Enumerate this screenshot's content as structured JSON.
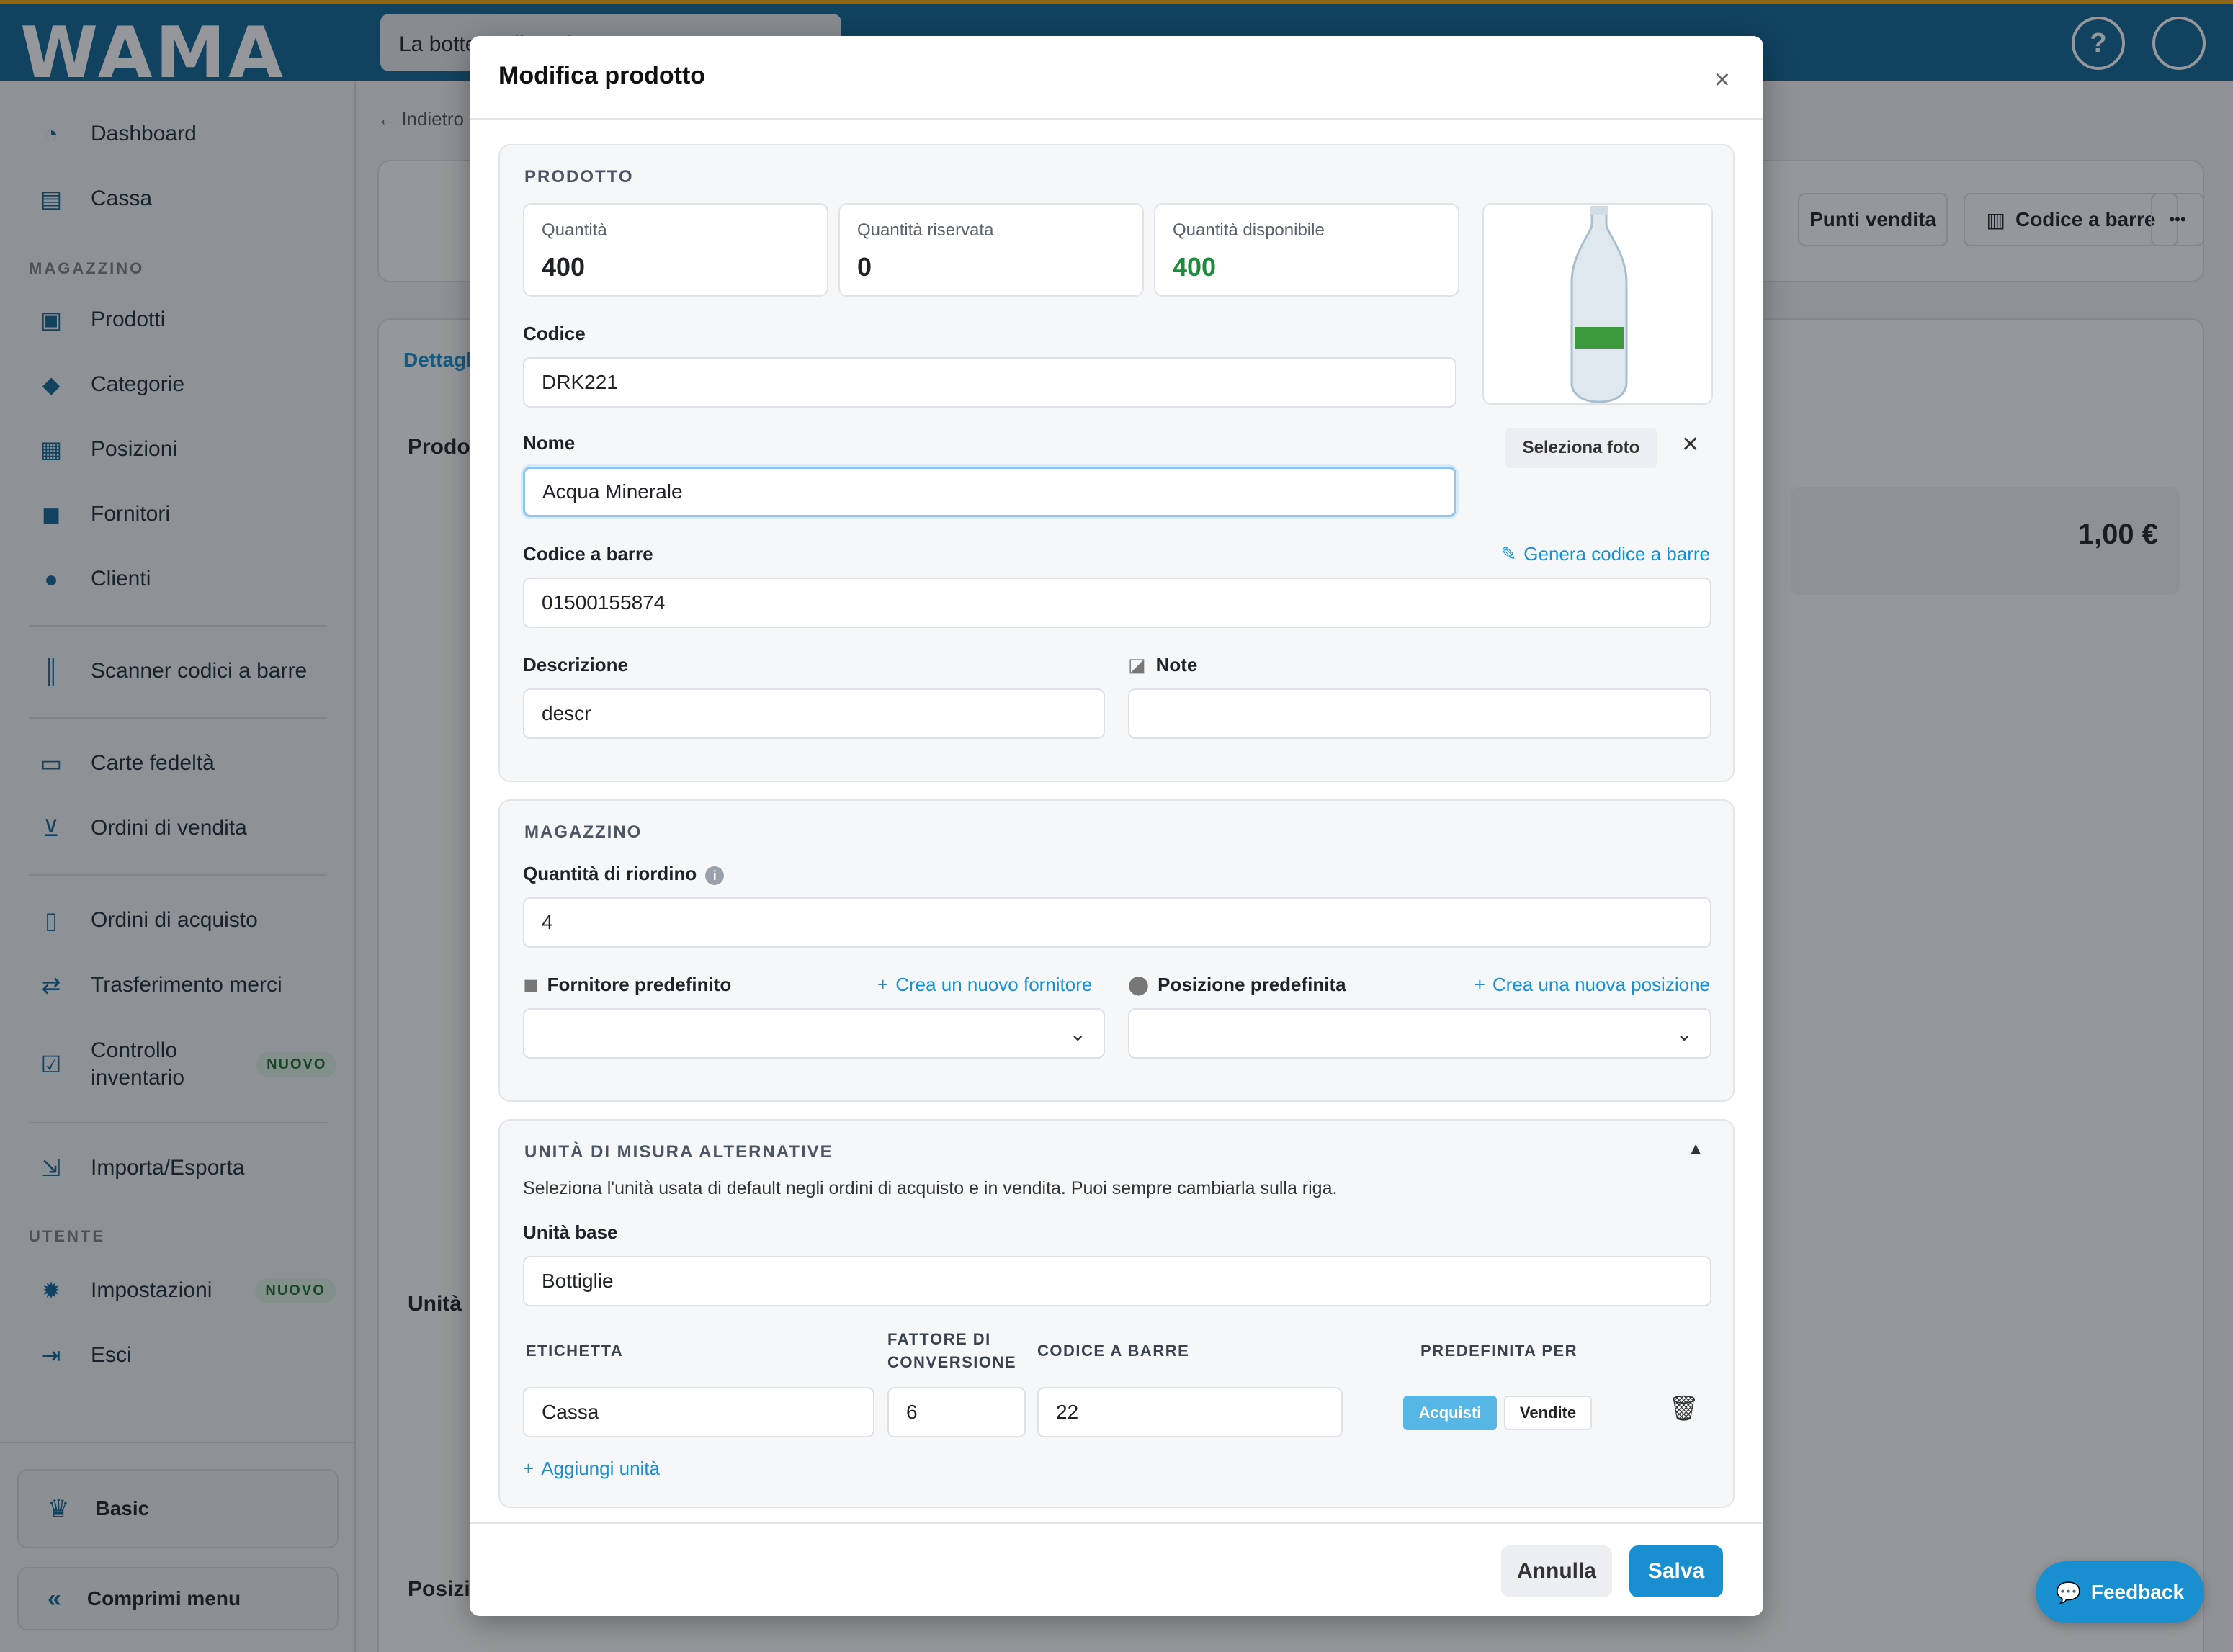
{
  "topbar": {
    "logo": "WAMA",
    "store": "La bottega di Mario",
    "help": "?"
  },
  "sidebar": {
    "items_top": [
      {
        "label": "Dashboard",
        "icon": "dashboard-icon"
      },
      {
        "label": "Cassa",
        "icon": "cash-register-icon"
      }
    ],
    "section_magazzino": "MAGAZZINO",
    "items_magazzino": [
      {
        "label": "Prodotti"
      },
      {
        "label": "Categorie"
      },
      {
        "label": "Posizioni"
      },
      {
        "label": "Fornitori"
      },
      {
        "label": "Clienti"
      }
    ],
    "scanner": "Scanner codici a barre",
    "carte": "Carte fedeltà",
    "ordini_vendita": "Ordini di vendita",
    "ordini_acquisto": "Ordini di acquisto",
    "trasferimento": "Trasferimento merci",
    "controllo_1": "Controllo",
    "controllo_2": "inventario",
    "badge_nuovo": "NUOVO",
    "importa": "Importa/Esporta",
    "section_utente": "UTENTE",
    "impostazioni": "Impostazioni",
    "esci": "Esci",
    "plan": "Basic",
    "collapse": "Comprimi menu"
  },
  "background": {
    "back": "Indietro",
    "tab": "Dettagli",
    "section_pro": "Prodotto",
    "section_uni": "Unità",
    "section_pos": "Posizioni",
    "btn_punti": "Punti vendita",
    "btn_barcode": "Codice a barre",
    "btn_more": "•••",
    "price": "1,00 €"
  },
  "modal": {
    "title": "Modifica prodotto",
    "close": "×",
    "prodotto": {
      "title": "PRODOTTO",
      "quantita_label": "Quantità",
      "quantita_value": "400",
      "riservata_label": "Quantità riservata",
      "riservata_value": "0",
      "disponibile_label": "Quantità disponibile",
      "disponibile_value": "400",
      "codice_label": "Codice",
      "codice_value": "DRK221",
      "nome_label": "Nome",
      "nome_value": "Acqua Minerale",
      "select_photo": "Seleziona foto",
      "remove_photo": "✕",
      "barcode_label": "Codice a barre",
      "barcode_value": "01500155874",
      "generate_barcode": "Genera codice a barre",
      "descrizione_label": "Descrizione",
      "descrizione_value": "descr",
      "note_label": "Note",
      "note_value": ""
    },
    "magazzino": {
      "title": "MAGAZZINO",
      "riordino_label": "Quantità di riordino",
      "riordino_value": "4",
      "fornitore_label": "Fornitore predefinito",
      "new_fornitore": "Crea un nuovo fornitore",
      "posizione_label": "Posizione predefinita",
      "new_posizione": "Crea una nuova posizione"
    },
    "unita": {
      "title": "UNITÀ DI MISURA ALTERNATIVE",
      "description": "Seleziona l'unità usata di default negli ordini di acquisto e in vendita. Puoi sempre cambiarla sulla riga.",
      "base_label": "Unità base",
      "base_value": "Bottiglie",
      "col_etichetta": "ETICHETTA",
      "col_fattore_1": "FATTORE DI",
      "col_fattore_2": "CONVERSIONE",
      "col_barcode": "CODICE A BARRE",
      "col_predefinita": "PREDEFINITA PER",
      "row": {
        "etichetta": "Cassa",
        "fattore": "6",
        "barcode": "22",
        "acquisti": "Acquisti",
        "vendite": "Vendite"
      },
      "add_unit": "Aggiungi unità"
    },
    "footer": {
      "cancel": "Annulla",
      "save": "Salva"
    }
  },
  "feedback": "Feedback",
  "colors": {
    "primary": "#0f6496",
    "accent": "#1a8fd0",
    "success": "#1e8a3a",
    "warning_stripe": "#f3a712"
  }
}
